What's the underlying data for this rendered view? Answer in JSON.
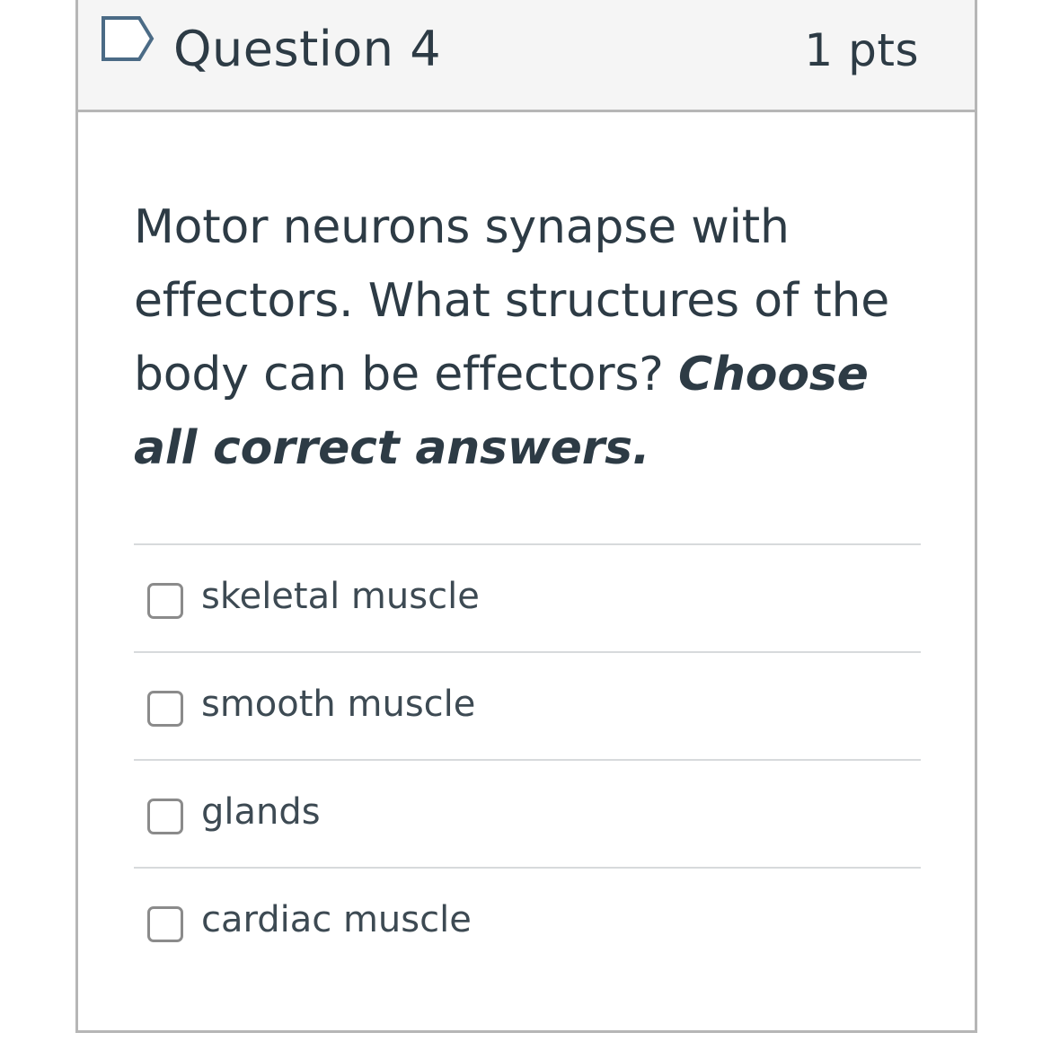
{
  "question": {
    "title": "Question 4",
    "points": "1 pts",
    "flag_icon": "flag-question-icon",
    "prompt_plain": "Motor neurons synapse with effectors. What structures of the body can be effectors?",
    "prompt_emphasis": "Choose all correct answers."
  },
  "answers": [
    {
      "label": "skeletal muscle",
      "checked": false
    },
    {
      "label": "smooth muscle",
      "checked": false
    },
    {
      "label": "glands",
      "checked": false
    },
    {
      "label": "cardiac muscle",
      "checked": false
    }
  ],
  "colors": {
    "text": "#2d3b45",
    "header_bg": "#f5f5f5",
    "border": "#b6b6b6",
    "flag": "#4b6b86",
    "checkbox_border": "#8b8b8b"
  }
}
